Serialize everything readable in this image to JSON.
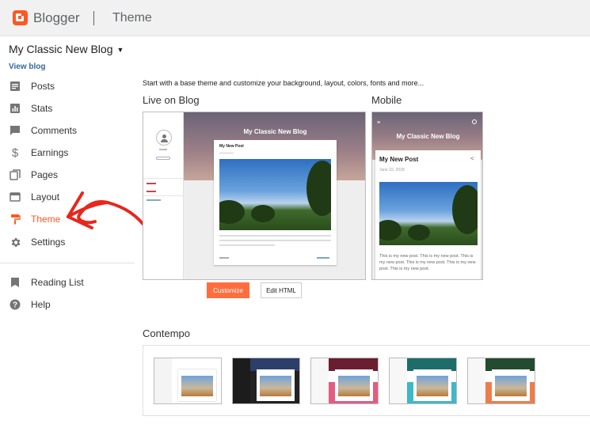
{
  "app": {
    "brand": "Blogger",
    "page_title": "Theme"
  },
  "blog": {
    "name": "My Classic New Blog",
    "view_link": "View blog"
  },
  "nav": {
    "items": [
      {
        "label": "Posts",
        "icon": "posts-icon"
      },
      {
        "label": "Stats",
        "icon": "stats-icon"
      },
      {
        "label": "Comments",
        "icon": "comments-icon"
      },
      {
        "label": "Earnings",
        "icon": "dollar-icon"
      },
      {
        "label": "Pages",
        "icon": "pages-icon"
      },
      {
        "label": "Layout",
        "icon": "layout-icon"
      },
      {
        "label": "Theme",
        "icon": "paint-roller-icon",
        "active": true
      },
      {
        "label": "Settings",
        "icon": "gear-icon"
      }
    ],
    "secondary": [
      {
        "label": "Reading List",
        "icon": "bookmark-icon"
      },
      {
        "label": "Help",
        "icon": "help-icon"
      }
    ]
  },
  "main": {
    "intro": "Start with a base theme and customize your background, layout, colors, fonts and more...",
    "live_label": "Live on Blog",
    "mobile_label": "Mobile",
    "customize_label": "Customize",
    "edit_html_label": "Edit HTML",
    "gallery_label": "Contempo"
  },
  "preview": {
    "blog_title": "My Classic New Blog",
    "post_title": "My New Post",
    "post_date": "June 22, 2018",
    "post_body": "This is my new post. This is my new post. This is my new post. This is my new post. This is my new post. This is my new post."
  },
  "colors": {
    "accent": "#ff5722",
    "customize_button": "#ff6d3f",
    "link": "#3367a4",
    "annotation_arrow": "#e8261c"
  }
}
